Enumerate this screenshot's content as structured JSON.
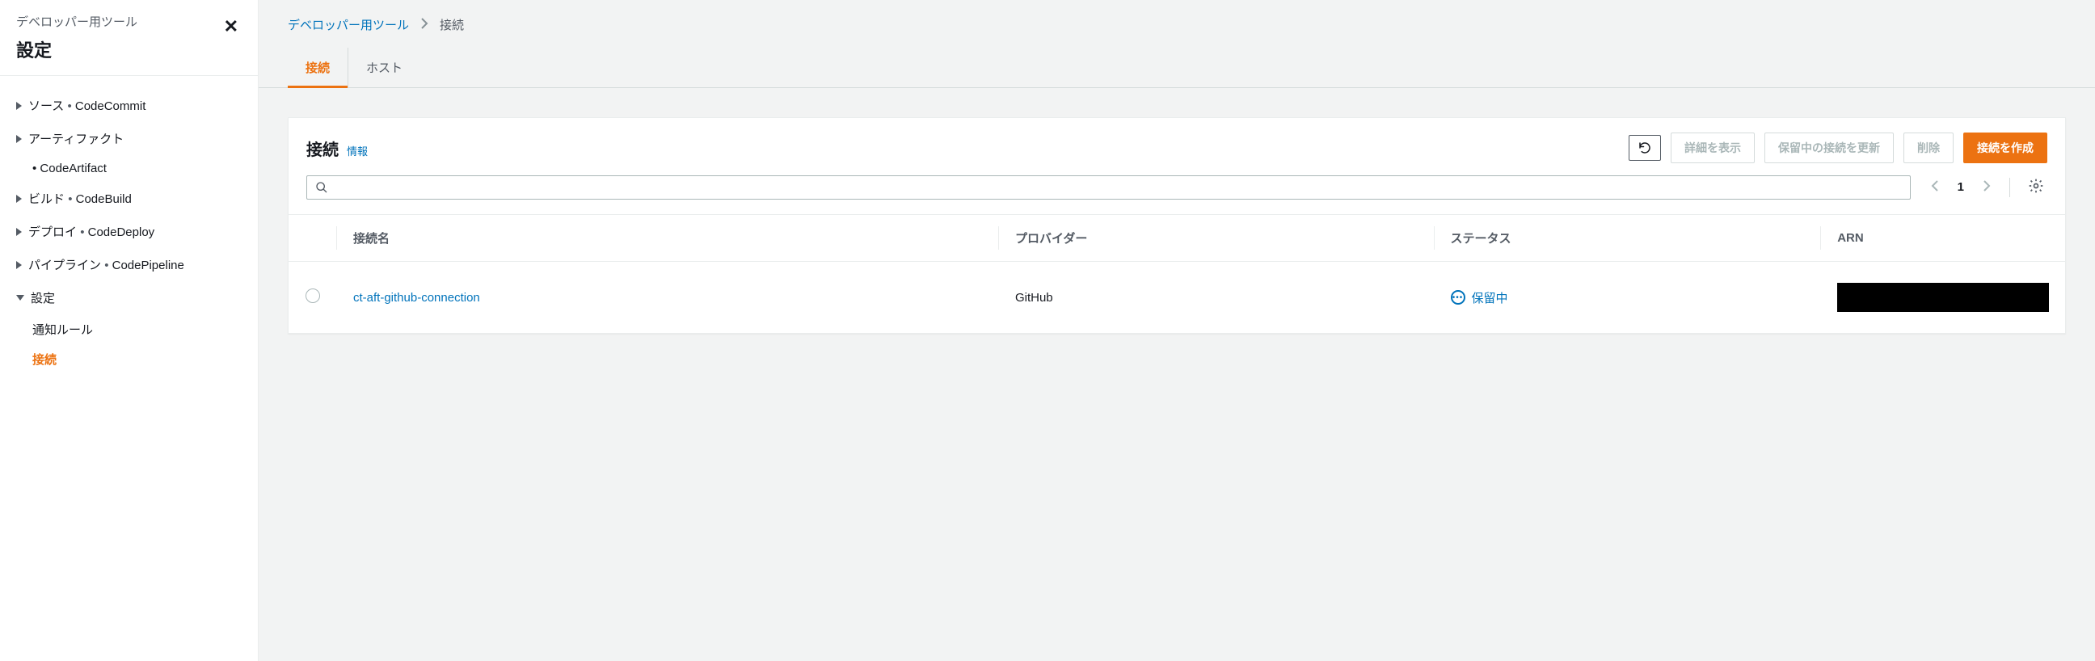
{
  "sidebar": {
    "sup": "デベロッパー用ツール",
    "title": "設定",
    "items": [
      {
        "label": "ソース",
        "extra": "CodeCommit",
        "expanded": false,
        "children": []
      },
      {
        "label": "アーティファクト",
        "extra": "",
        "expanded": false,
        "children": [
          {
            "label": "CodeArtifact",
            "active": false
          }
        ]
      },
      {
        "label": "ビルド",
        "extra": "CodeBuild",
        "expanded": false,
        "children": []
      },
      {
        "label": "デプロイ",
        "extra": "CodeDeploy",
        "expanded": false,
        "children": []
      },
      {
        "label": "パイプライン",
        "extra": "CodePipeline",
        "expanded": false,
        "children": []
      },
      {
        "label": "設定",
        "extra": "",
        "expanded": true,
        "children": [
          {
            "label": "通知ルール",
            "active": false
          },
          {
            "label": "接続",
            "active": true
          }
        ]
      }
    ]
  },
  "breadcrumb": {
    "root": "デベロッパー用ツール",
    "current": "接続"
  },
  "tabs": [
    {
      "label": "接続",
      "active": true
    },
    {
      "label": "ホスト",
      "active": false
    }
  ],
  "panel": {
    "title": "接続",
    "info": "情報",
    "actions": {
      "view_details": "詳細を表示",
      "update_pending": "保留中の接続を更新",
      "delete": "削除",
      "create": "接続を作成"
    },
    "search_placeholder": "",
    "page": "1"
  },
  "table": {
    "headers": {
      "name": "接続名",
      "provider": "プロバイダー",
      "status": "ステータス",
      "arn": "ARN"
    },
    "rows": [
      {
        "name": "ct-aft-github-connection",
        "provider": "GitHub",
        "status": "保留中",
        "arn": ""
      }
    ]
  }
}
